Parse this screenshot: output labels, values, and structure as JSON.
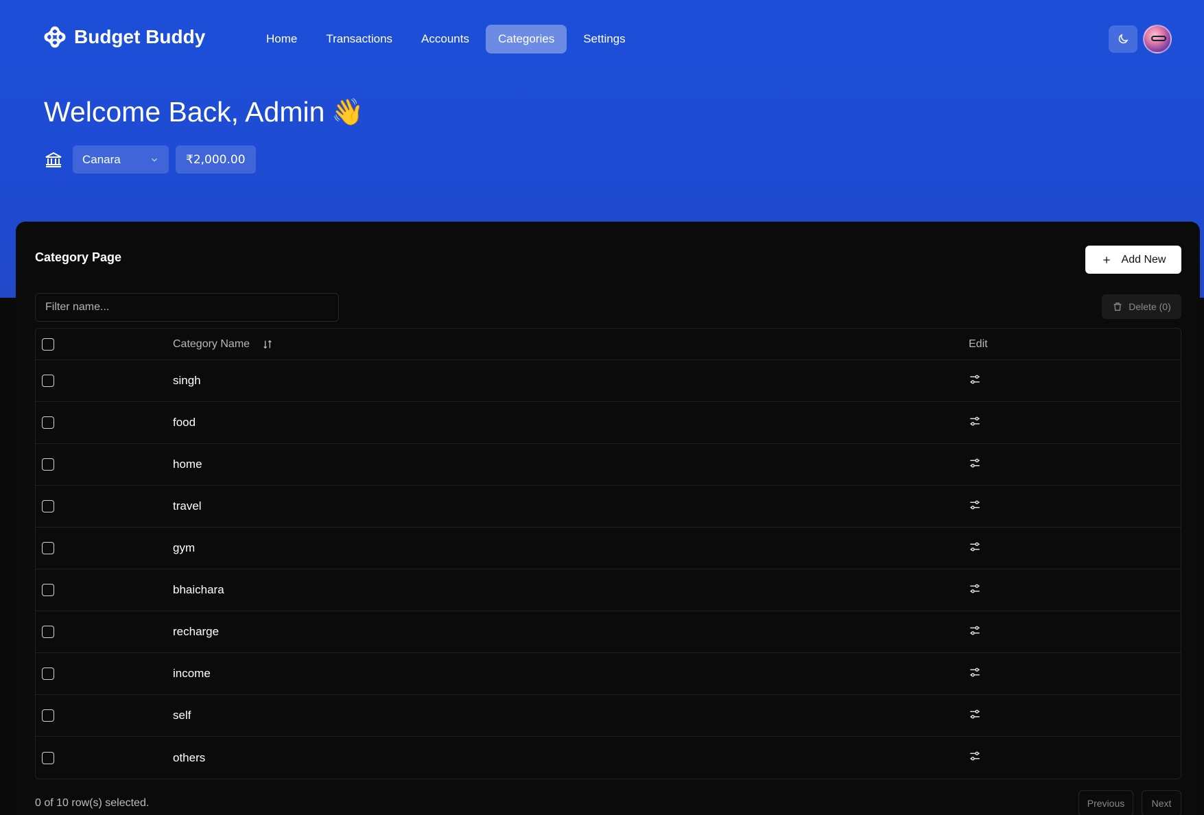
{
  "app": {
    "name": "Budget Buddy"
  },
  "nav": {
    "items": [
      {
        "label": "Home"
      },
      {
        "label": "Transactions"
      },
      {
        "label": "Accounts"
      },
      {
        "label": "Categories",
        "active": true
      },
      {
        "label": "Settings"
      }
    ]
  },
  "header": {
    "welcome": "Welcome Back, Admin",
    "wave_emoji": "👋",
    "account": "Canara",
    "balance": "₹2,000.00"
  },
  "page": {
    "title": "Category Page",
    "add_label": "Add New",
    "filter_placeholder": "Filter name...",
    "delete_label": "Delete (0)"
  },
  "table": {
    "col_name": "Category Name",
    "col_edit": "Edit",
    "rows": [
      {
        "name": "singh"
      },
      {
        "name": "food"
      },
      {
        "name": "home"
      },
      {
        "name": "travel"
      },
      {
        "name": "gym"
      },
      {
        "name": "bhaichara"
      },
      {
        "name": "recharge"
      },
      {
        "name": "income"
      },
      {
        "name": "self"
      },
      {
        "name": "others"
      }
    ]
  },
  "footer": {
    "selection": "0 of 10 row(s) selected.",
    "previous": "Previous",
    "next": "Next"
  },
  "colors": {
    "primary": "#1d4fd9",
    "background": "#0a0a0a"
  },
  "icons": {
    "logo": "logo-icon",
    "theme": "moon-icon",
    "bank": "bank-icon",
    "add": "plus-icon",
    "delete": "trash-icon",
    "sort": "sort-icon",
    "edit": "sliders-icon"
  }
}
